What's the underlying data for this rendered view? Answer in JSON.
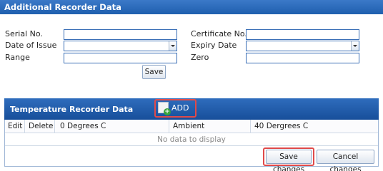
{
  "recorder": {
    "title": "Additional Recorder Data",
    "serial_label": "Serial No.",
    "serial_value": "",
    "date_of_issue_label": "Date of Issue",
    "date_of_issue_value": "",
    "range_label": "Range",
    "range_value": "",
    "certificate_label": "Certificate No.",
    "certificate_value": "",
    "expiry_label": "Expiry Date",
    "expiry_value": "",
    "zero_label": "Zero",
    "zero_value": "",
    "save_label": "Save"
  },
  "temperature": {
    "title": "Temperature Recorder Data",
    "add_label": "ADD",
    "columns": [
      "Edit",
      "Delete",
      "0 Degrees C",
      "Ambient",
      "40 Dergrees C"
    ],
    "empty_message": "No data to display",
    "save_changes_label": "Save changes",
    "cancel_changes_label": "Cancel changes"
  },
  "colors": {
    "header_blue": "#1f5fae",
    "input_border": "#3a6fb6",
    "highlight_red": "#e04a4a"
  }
}
